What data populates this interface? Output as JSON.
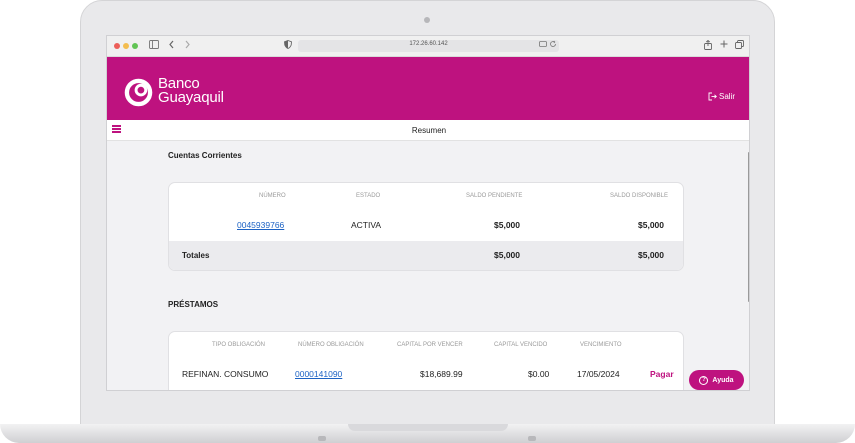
{
  "browser": {
    "url": "172.26.60.142"
  },
  "header": {
    "logo_line1": "Banco",
    "logo_line2": "Guayaquil",
    "salir_label": "Salir"
  },
  "subheader": {
    "title": "Resumen"
  },
  "cuentas": {
    "section_title": "Cuentas Corrientes",
    "columns": [
      "NÚMERO",
      "ESTADO",
      "SALDO PENDIENTE",
      "SALDO DISPONIBLE"
    ],
    "rows": [
      {
        "numero": "0045939766",
        "estado": "ACTIVA",
        "saldo_pendiente": "$5,000",
        "saldo_disponible": "$5,000"
      }
    ],
    "totals": {
      "label": "Totales",
      "saldo_pendiente": "$5,000",
      "saldo_disponible": "$5,000"
    }
  },
  "prestamos": {
    "section_title": "PRÉSTAMOS",
    "columns": [
      "TIPO OBLIGACIÓN",
      "NÚMERO OBLIGACIÓN",
      "CAPITAL POR VENCER",
      "CAPITAL VENCIDO",
      "VENCIMIENTO"
    ],
    "rows": [
      {
        "tipo": "REFINAN. CONSUMO",
        "numero": "0000141090",
        "capital_por_vencer": "$18,689.99",
        "capital_vencido": "$0.00",
        "vencimiento": "17/05/2024",
        "action": "Pagar"
      }
    ]
  },
  "help": {
    "label": "Ayuda",
    "icon": "?"
  },
  "colors": {
    "brand": "#be127f",
    "link": "#1c62c4"
  }
}
